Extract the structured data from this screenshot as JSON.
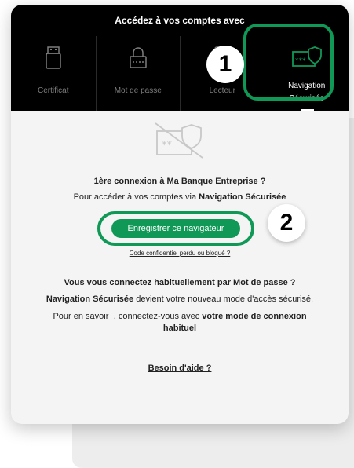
{
  "header": {
    "title": "Accédez à vos comptes avec"
  },
  "tabs": [
    {
      "label": "Certificat",
      "icon": "usb-key-icon"
    },
    {
      "label": "Mot de passe",
      "icon": "lock-keyboard-icon"
    },
    {
      "label": "Lecteur",
      "icon": "card-reader-icon"
    },
    {
      "label_line1": "Navigation",
      "label_line2": "Sécurisée",
      "icon": "secure-card-shield-icon",
      "active": true
    }
  ],
  "badges": {
    "first": "1",
    "second": "2"
  },
  "content": {
    "illustration_icon": "secure-card-shield-crossed-icon",
    "first_login_title": "1ère connexion à Ma Banque Entreprise ?",
    "access_text_prefix": "Pour accéder à vos comptes via ",
    "access_text_bold": "Navigation Sécurisée",
    "register_button": "Enregistrer ce navigateur",
    "lost_code_link": "Code confidentiel perdu ou bloqué ?",
    "password_user_title": "Vous vous connectez habituellement par Mot de passe ?",
    "new_mode_bold": "Navigation Sécurisée",
    "new_mode_text": " devient votre nouveau mode d'accès sécurisé.",
    "learn_more_prefix": "Pour en savoir+, connectez-vous avec ",
    "learn_more_bold_line1": "votre mode de connexion",
    "learn_more_bold_line2": "habituel",
    "help_link": "Besoin d'aide ?"
  },
  "colors": {
    "brand_green": "#109857",
    "header_bg": "#000000",
    "panel_bg": "#f4f4f4"
  }
}
